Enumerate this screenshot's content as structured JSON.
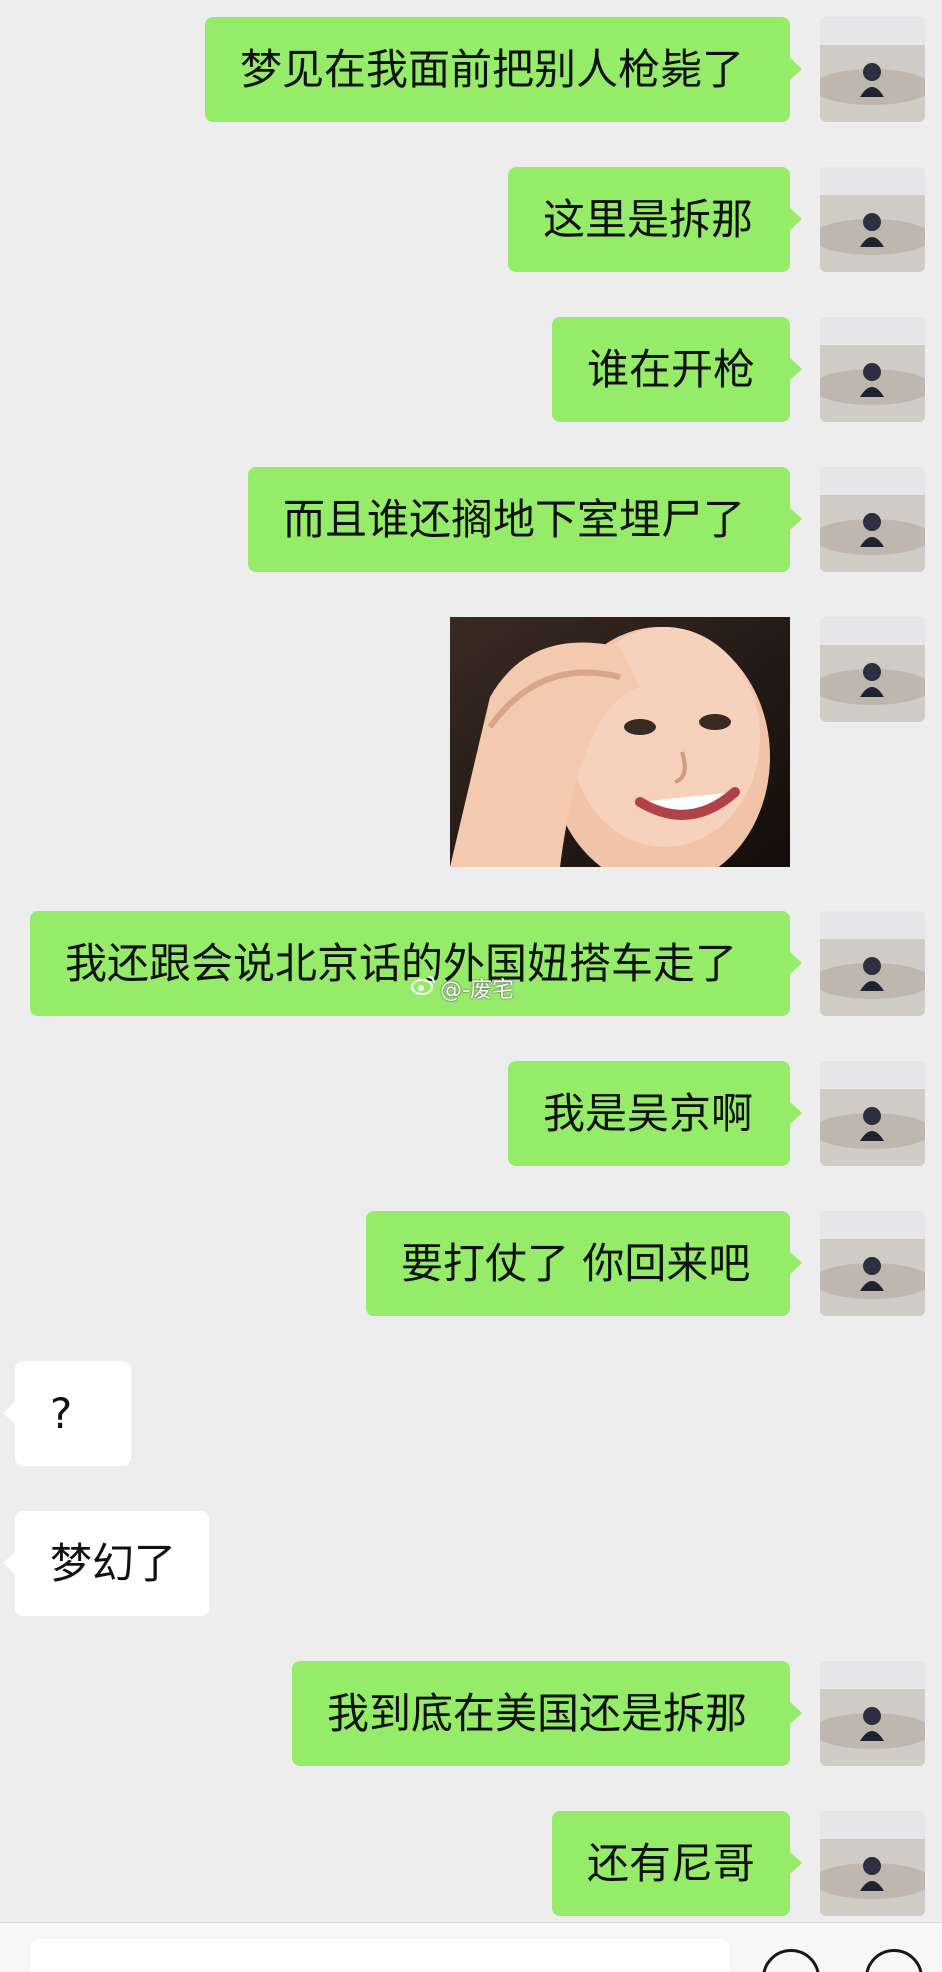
{
  "messages": [
    {
      "side": "out",
      "type": "text",
      "text": "梦见在我面前把别人枪毙了"
    },
    {
      "side": "out",
      "type": "text",
      "text": "这里是拆那"
    },
    {
      "side": "out",
      "type": "text",
      "text": "谁在开枪"
    },
    {
      "side": "out",
      "type": "text",
      "text": "而且谁还搁地下室埋尸了"
    },
    {
      "side": "out",
      "type": "sticker",
      "text": ""
    },
    {
      "side": "out",
      "type": "text",
      "text": "我还跟会说北京话的外国妞搭车走了"
    },
    {
      "side": "out",
      "type": "text",
      "text": "我是吴京啊"
    },
    {
      "side": "out",
      "type": "text",
      "text": "要打仗了 你回来吧"
    },
    {
      "side": "in",
      "type": "text",
      "text": "?"
    },
    {
      "side": "in",
      "type": "text",
      "text": "梦幻了"
    },
    {
      "side": "out",
      "type": "text",
      "text": "我到底在美国还是拆那"
    },
    {
      "side": "out",
      "type": "text",
      "text": "还有尼哥"
    }
  ],
  "watermark": {
    "icon": "weibo-icon",
    "text": "@-废宅"
  },
  "colors": {
    "background": "#ededed",
    "outgoing_bubble": "#95ec69",
    "incoming_bubble": "#ffffff",
    "text": "#111111"
  },
  "icons": {
    "avatar": "avatar-beach-photo",
    "voice": "voice-icon",
    "emoji": "emoji-icon"
  }
}
